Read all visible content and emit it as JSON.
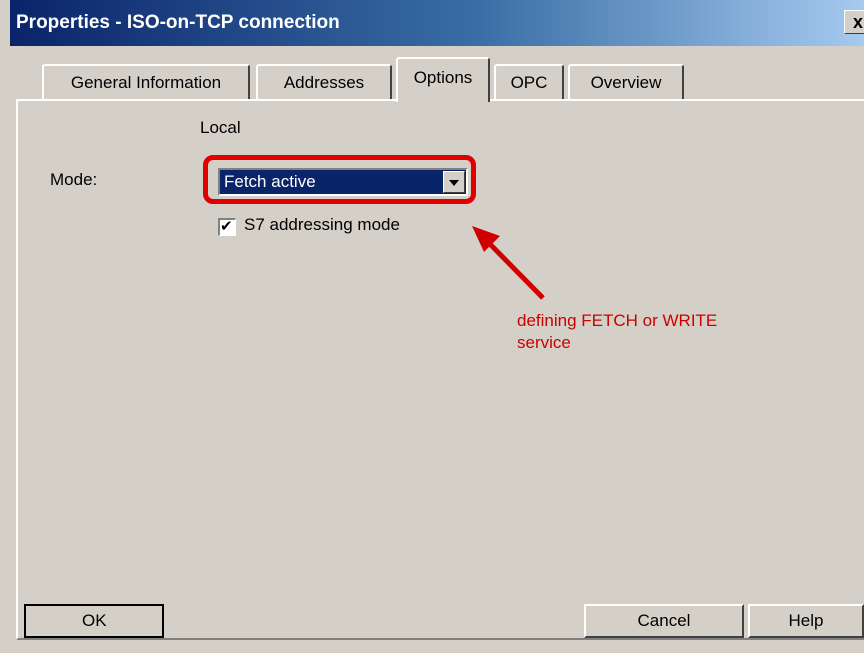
{
  "window": {
    "title": "Properties - ISO-on-TCP connection",
    "close_label": "x"
  },
  "tabs": [
    {
      "label": "General Information",
      "active": false
    },
    {
      "label": "Addresses",
      "active": false
    },
    {
      "label": "Options",
      "active": true
    },
    {
      "label": "OPC",
      "active": false
    },
    {
      "label": "Overview",
      "active": false
    }
  ],
  "options": {
    "section_label": "Local",
    "mode_label": "Mode:",
    "mode_value": "Fetch active",
    "s7_label": "S7 addressing mode",
    "s7_checked": true,
    "check_glyph": "✔"
  },
  "annotation": {
    "line1": "defining FETCH or WRITE",
    "line2": "service",
    "color": "#cc0000"
  },
  "buttons": {
    "ok": "OK",
    "cancel": "Cancel",
    "help": "Help"
  },
  "icons": {
    "close": "close-icon",
    "dropdown": "chevron-down-icon",
    "check": "checkmark-icon"
  }
}
